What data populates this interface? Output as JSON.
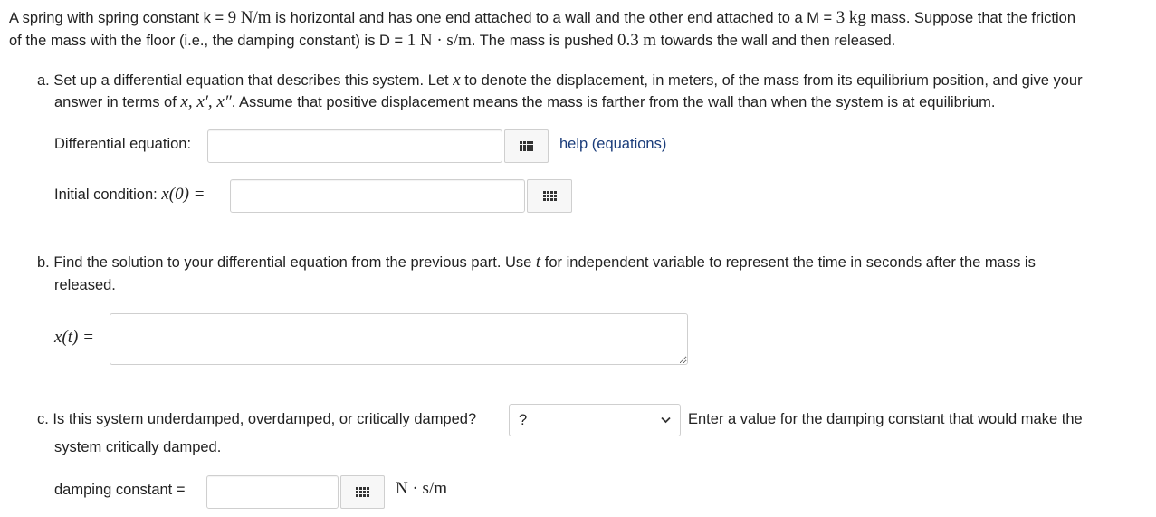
{
  "intro": {
    "line1_a": "A spring with spring constant k = ",
    "k_value": "9",
    "k_unit": "N/m",
    "line1_b": " is horizontal and has one end attached to a wall and the other end attached to a M = ",
    "m_value": "3",
    "m_unit": "kg",
    "line1_c": " mass. Suppose that the friction",
    "line2_a": "of the mass with the floor (i.e., the damping constant) is D = ",
    "d_value": "1",
    "d_unit": "N · s/m",
    "line2_b": ". The mass is pushed ",
    "push_value": "0.3",
    "push_unit": "m",
    "line2_c": " towards the wall and then released."
  },
  "part_a": {
    "line1_a": "a. Set up a differential equation that describes this system. Let ",
    "var_x": "x",
    "line1_b": " to denote the displacement, in meters, of the mass from its equilibrium position, and give your",
    "line2_a": "answer in terms of ",
    "vars_list": "x, x′, x″",
    "line2_b": ". Assume that positive displacement means the mass is farther from the wall than when the system is at equilibrium.",
    "de_label": "Differential equation:",
    "de_value": "",
    "help_link": "help (equations)",
    "ic_label_a": "Initial condition: ",
    "ic_math": "x(0) =",
    "ic_value": ""
  },
  "part_b": {
    "line1_a": "b. Find the solution to your differential equation from the previous part. Use ",
    "var_t": "t",
    "line1_b": " for independent variable to represent the time in seconds after the mass is",
    "line2": "released.",
    "xt_label": "x(t) =",
    "xt_value": ""
  },
  "part_c": {
    "line1_a": "c. Is this system underdamped, overdamped, or critically damped?",
    "select_value": "?",
    "line1_b": "Enter a value for the damping constant that would make the",
    "line2": "system critically damped.",
    "dc_label": "damping constant =",
    "dc_value": "",
    "dc_unit": "N · s/m"
  },
  "icons": {
    "equation_editor": "grid-icon",
    "dropdown": "chevron-down-icon"
  },
  "colors": {
    "link": "#1a3c7a",
    "border": "#cfcfcf"
  }
}
